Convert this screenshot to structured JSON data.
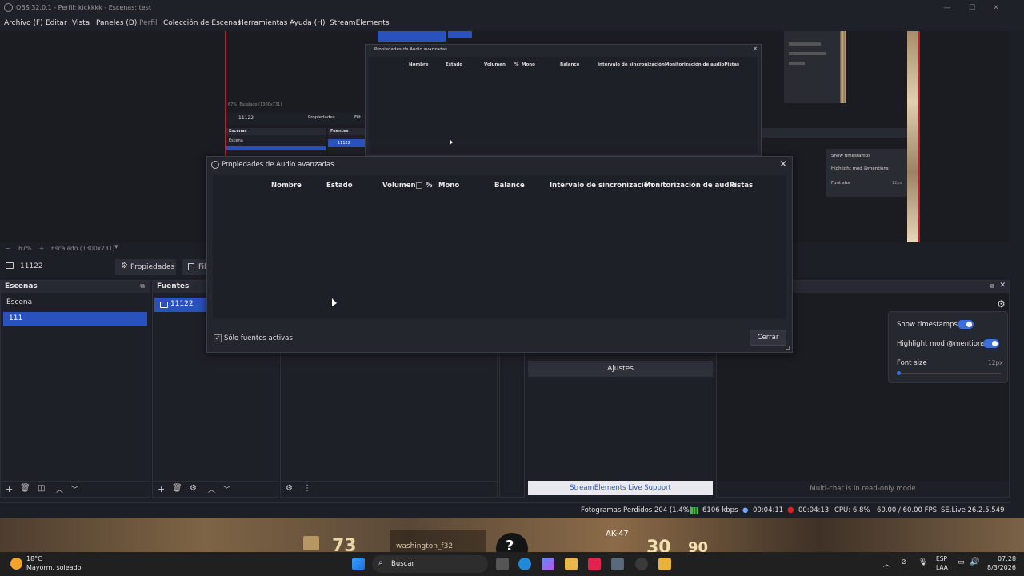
{
  "window": {
    "title": "OBS 32.0.1 - Perfil: kickkkk - Escenas: test",
    "minimize": "—",
    "maximize": "☐",
    "close": "✕"
  },
  "menu": {
    "items": [
      "Archivo (F)",
      "Editar",
      "Vista",
      "Paneles (D)",
      "Perfil",
      "Colección de Escenas",
      "Herramientas",
      "Ayuda (H)",
      "StreamElements"
    ]
  },
  "preview": {
    "zoom": "67%",
    "scale_label": "Escalado (1300x731)",
    "zoom_minus": "−",
    "zoom_plus": "+"
  },
  "scenebar": {
    "source_name": "11122",
    "properties_label": "Propiedades",
    "filters_label": "Filt"
  },
  "scenes": {
    "title": "Escenas",
    "items": [
      "Escena",
      "111"
    ],
    "selected_index": 1
  },
  "sources": {
    "title": "Fuentes",
    "items": [
      "11122"
    ]
  },
  "dialog": {
    "title": "Propiedades de Audio avanzadas",
    "columns": [
      "Nombre",
      "Estado",
      "Volumen",
      "%",
      "Mono",
      "Balance",
      "Intervalo de sincronización",
      "Monitorización de audio",
      "Pistas"
    ],
    "only_active_label": "Sólo fuentes activas",
    "only_active_checked": true,
    "close_button": "Cerrar"
  },
  "ghost_dialog": {
    "title": "Propiedades de Audio avanzadas",
    "columns": [
      "Nombre",
      "Estado",
      "Volumen",
      "%",
      "Mono",
      "Balance",
      "Intervalo de sincronizaciónMonitorización de audioPistas"
    ],
    "mini_scenes": "Escenas",
    "mini_sources": "Fuentes",
    "mini_scene_item": "Escena",
    "mini_source": "11122",
    "mini_props": "Propiedades",
    "mini_filters": "Filt",
    "mini_zoom": "67%",
    "mini_scale": "Escalado (1300x731)"
  },
  "chat_settings": {
    "show_timestamps": "Show timestamps",
    "highlight_mentions": "Highlight mod @mentions",
    "font_size": "Font size",
    "font_size_value": "12px",
    "show_timestamps_on": true,
    "highlight_mentions_on": true
  },
  "streamelements": {
    "settings_button": "Ajustes",
    "support_button": "StreamElements Live Support"
  },
  "multichat": {
    "notice": "Multi-chat is in read-only mode"
  },
  "status": {
    "dropped_frames": "Fotogramas Perdidos 204 (1.4%)",
    "bitrate": "6106 kbps",
    "stream_time": "00:04:11",
    "rec_time": "00:04:13",
    "cpu": "CPU: 6.8%",
    "fps": "60.00 / 60.00 FPS",
    "version": "SE.Live 26.2.5.549"
  },
  "game_hud": {
    "health": "73",
    "player": "washington_f32",
    "round": "?",
    "weapon": "AK-47",
    "ammo": "30",
    "reserve": "90"
  },
  "taskbar": {
    "weather_temp": "18°C",
    "weather_desc": "Mayorm. soleado",
    "search_label": "Buscar",
    "lang_top": "ESP",
    "lang_bottom": "LAA",
    "time": "07:28",
    "date": "8/3/2026"
  },
  "colors": {
    "accent": "#2a52be",
    "toggle": "#3b6fe0",
    "record": "#e02020",
    "bitrate_green": "#3fbf3f"
  }
}
